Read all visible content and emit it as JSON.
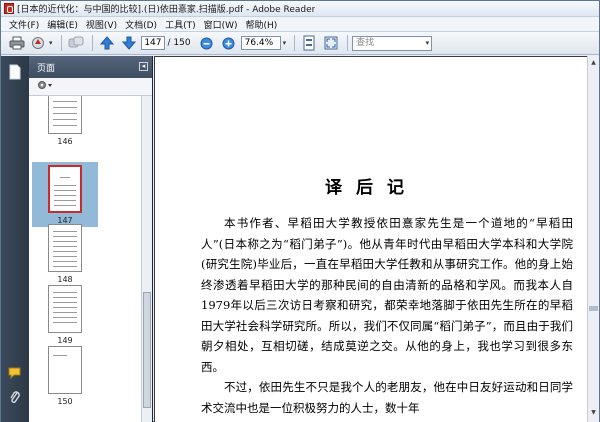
{
  "window": {
    "title": "[日本的近代化：与中国的比较].(日)依田憙家.扫描版.pdf - Adobe Reader"
  },
  "menu": [
    "文件(F)",
    "编辑(E)",
    "视图(V)",
    "文档(D)",
    "工具(T)",
    "窗口(W)",
    "帮助(H)"
  ],
  "toolbar": {
    "current_page": "147",
    "total_pages": "/ 150",
    "zoom": "76.4%",
    "search_placeholder": "查找",
    "dropdown_glyph": "▾"
  },
  "panel": {
    "title": "页面",
    "collapse_glyph": "◂"
  },
  "thumbnails": [
    {
      "label": "146"
    },
    {
      "label": "147",
      "selected": true
    },
    {
      "label": "148"
    },
    {
      "label": "149"
    },
    {
      "label": "150"
    }
  ],
  "document": {
    "heading": "译后记",
    "paragraphs": [
      "本书作者、早稻田大学教授依田憙家先生是一个道地的“早稻田人”(日本称之为“稻门弟子”)。他从青年时代由早稻田大学本科和大学院(研究生院)毕业后，一直在早稻田大学任教和从事研究工作。他的身上始终渗透着早稻田大学的那种民间的自由清新的品格和学风。而我本人自1979年以后三次访日考察和研究，都荣幸地落脚于依田先生所在的早稻田大学社会科学研究所。所以，我们不仅同属“稻门弟子”，而且由于我们朝夕相处，互相切磋，结成莫逆之交。从他的身上，我也学习到很多东西。",
      "不过，依田先生不只是我个人的老朋友，他在中日友好运动和日同学术交流中也是一位积极努力的人士，数十年"
    ]
  },
  "colors": {
    "rail": "#2d3846",
    "panel": "#3c4a5b",
    "thumb_selected": "#93b9d9",
    "selected_border": "#c72b2b",
    "nav_blue": "#2f7fd6"
  }
}
